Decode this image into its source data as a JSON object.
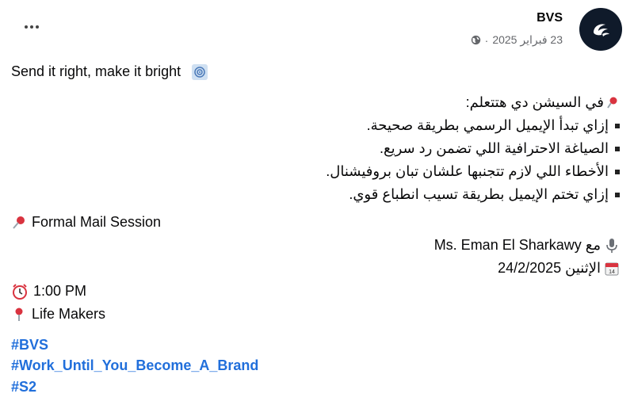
{
  "header": {
    "page_name": "BVS",
    "date": "23 فبراير 2025",
    "separator": "·",
    "more_icon": "more-horizontal-icon",
    "privacy_icon": "globe-icon"
  },
  "post": {
    "intro": "Send it right, make it bright",
    "learn_heading": "في السيشن دي هتتعلم:",
    "learn_items": [
      "إزاي تبدأ الإيميل الرسمي بطريقة صحيحة.",
      "الصياغة الاحترافية اللي تضمن رد سريع.",
      "الأخطاء اللي لازم تتجنبها علشان تبان بروفيشنال.",
      "إزاي تختم الإيميل بطريقة تسيب انطباع قوي."
    ],
    "session_title": "Formal Mail Session",
    "with_prefix": "مع",
    "speaker": "Ms. Eman El Sharkawy",
    "day": "الإثنين",
    "date": "24/2/2025",
    "time": "1:00 PM",
    "location": "Life Makers",
    "hashtags": [
      "#BVS",
      "#Work_Until_You_Become_A_Brand",
      "#S2"
    ]
  },
  "colors": {
    "link": "#216fdb",
    "muted": "#65676b",
    "pin": "#d9333f"
  }
}
